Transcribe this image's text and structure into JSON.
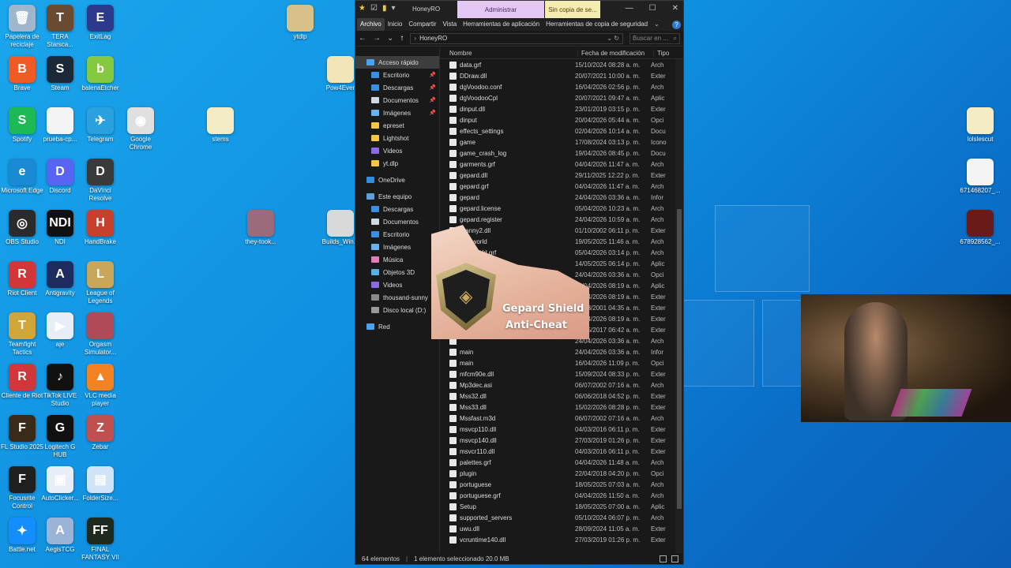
{
  "desktop": {
    "icons": [
      {
        "label": "Papelera de reciclaje",
        "color": "#9fb7cc",
        "glyph": "🗑"
      },
      {
        "label": "TERA Starsca...",
        "color": "#6b4a32",
        "glyph": "T"
      },
      {
        "label": "ExitLag",
        "color": "#2d3a8c",
        "glyph": "E"
      },
      {
        "label": "ytdlp",
        "color": "#d7c188",
        "glyph": ""
      },
      {
        "label": "Brave",
        "color": "#f05a24",
        "glyph": "B"
      },
      {
        "label": "Steam",
        "color": "#1b2838",
        "glyph": "S"
      },
      {
        "label": "balenaEtcher",
        "color": "#85c940",
        "glyph": "b"
      },
      {
        "label": "Pow4Ever",
        "color": "#f2e6b8",
        "glyph": ""
      },
      {
        "label": "Spotify",
        "color": "#1db954",
        "glyph": "S"
      },
      {
        "label": "prueba-cp...",
        "color": "#f4f4f4",
        "glyph": ""
      },
      {
        "label": "Telegram",
        "color": "#2aa1de",
        "glyph": "✈"
      },
      {
        "label": "Google Chrome",
        "color": "#e0e0e0",
        "glyph": "◉"
      },
      {
        "label": "stems",
        "color": "#f4ecc4",
        "glyph": ""
      },
      {
        "label": "Microsoft Edge",
        "color": "#1a8ad4",
        "glyph": "e"
      },
      {
        "label": "Discord",
        "color": "#5865f2",
        "glyph": "D"
      },
      {
        "label": "DaVinci Resolve",
        "color": "#3a3a3a",
        "glyph": "D"
      },
      {
        "label": "OBS Studio",
        "color": "#2b2b2b",
        "glyph": "◎"
      },
      {
        "label": "NDI",
        "color": "#111111",
        "glyph": "NDI"
      },
      {
        "label": "HandBrake",
        "color": "#c7402b",
        "glyph": "H"
      },
      {
        "label": "they-took...",
        "color": "#9b6b7b",
        "glyph": ""
      },
      {
        "label": "Builds_Win...",
        "color": "#d9d9d9",
        "glyph": ""
      },
      {
        "label": "Riot Client",
        "color": "#d13639",
        "glyph": "R"
      },
      {
        "label": "Antigravity",
        "color": "#1d2b5e",
        "glyph": "A"
      },
      {
        "label": "League of Legends",
        "color": "#c8a75a",
        "glyph": "L"
      },
      {
        "label": "Teamfight Tactics",
        "color": "#d0a53a",
        "glyph": "T"
      },
      {
        "label": "aje",
        "color": "#e8eef8",
        "glyph": "▶"
      },
      {
        "label": "Orgasm Simulator...",
        "color": "#b04a5a",
        "glyph": ""
      },
      {
        "label": "Cliente de Riot",
        "color": "#d13639",
        "glyph": "R"
      },
      {
        "label": "TikTok LIVE Studio",
        "color": "#111111",
        "glyph": "♪"
      },
      {
        "label": "VLC media player",
        "color": "#f58220",
        "glyph": "▲"
      },
      {
        "label": "FL Studio 2025",
        "color": "#3a2a1a",
        "glyph": "F"
      },
      {
        "label": "Logitech G HUB",
        "color": "#111111",
        "glyph": "G"
      },
      {
        "label": "Zebar",
        "color": "#c0504d",
        "glyph": "Z"
      },
      {
        "label": "Focusrite Control",
        "color": "#1f1f1f",
        "glyph": "F"
      },
      {
        "label": "AutoClicker...",
        "color": "#e8eef8",
        "glyph": "▣"
      },
      {
        "label": "FolderSize...",
        "color": "#d0e4f7",
        "glyph": "▤"
      },
      {
        "label": "Battle.net",
        "color": "#148eff",
        "glyph": "✦"
      },
      {
        "label": "AegisTCG",
        "color": "#9ab4d8",
        "glyph": "A"
      },
      {
        "label": "FINAL FANTASY VII",
        "color": "#1f2a1f",
        "glyph": "FF"
      },
      {
        "label": "lolslescut",
        "color": "#f4ecc4",
        "glyph": ""
      },
      {
        "label": "671468207_...",
        "color": "#f4f4f4",
        "glyph": ""
      },
      {
        "label": "678928562_...",
        "color": "#6b1a1a",
        "glyph": ""
      }
    ]
  },
  "explorer": {
    "title": "HoneyRO",
    "context_admin": "Administrar",
    "context_backup": "Sin copia de se...",
    "ribbon_tabs": [
      "Archivo",
      "Inicio",
      "Compartir",
      "Vista",
      "Herramientas de aplicación",
      "Herramientas de copia de seguridad"
    ],
    "address": "HoneyRO",
    "search_placeholder": "Buscar en ...",
    "columns": {
      "name": "Nombre",
      "date": "Fecha de modificación",
      "type": "Tipo"
    },
    "nav_items": [
      {
        "label": "Acceso rápido",
        "color": "#4aa3f0",
        "top": true,
        "sel": true
      },
      {
        "label": "Escritorio",
        "color": "#3a8fe0",
        "pin": true
      },
      {
        "label": "Descargas",
        "color": "#3a8fe0",
        "pin": true
      },
      {
        "label": "Documentos",
        "color": "#cfd8e3",
        "pin": true
      },
      {
        "label": "Imágenes",
        "color": "#6cb0f0",
        "pin": true
      },
      {
        "label": "epreset",
        "color": "#f2c744"
      },
      {
        "label": "Lightshot",
        "color": "#f2c744"
      },
      {
        "label": "Videos",
        "color": "#8a6be0"
      },
      {
        "label": "yt.dlp",
        "color": "#f2c744"
      },
      {
        "gap": true
      },
      {
        "label": "OneDrive",
        "color": "#2f8de4",
        "top": true
      },
      {
        "gap": true
      },
      {
        "label": "Este equipo",
        "color": "#5aa0e0",
        "top": true
      },
      {
        "label": "Descargas",
        "color": "#3a8fe0"
      },
      {
        "label": "Documentos",
        "color": "#cfd8e3"
      },
      {
        "label": "Escritorio",
        "color": "#3a8fe0"
      },
      {
        "label": "Imágenes",
        "color": "#6cb0f0"
      },
      {
        "label": "Música",
        "color": "#e57ab8"
      },
      {
        "label": "Objetos 3D",
        "color": "#58b0e8"
      },
      {
        "label": "Videos",
        "color": "#8a6be0"
      },
      {
        "label": "thousand-sunny",
        "color": "#8a8a8a"
      },
      {
        "label": "Disco local (D:)",
        "color": "#9a9a9a"
      },
      {
        "gap": true
      },
      {
        "label": "Red",
        "color": "#4aa3f0",
        "top": true
      }
    ],
    "files": [
      {
        "name": "data.grf",
        "date": "15/10/2024 08:28 a. m.",
        "type": "Arch"
      },
      {
        "name": "DDraw.dll",
        "date": "20/07/2021 10:00 a. m.",
        "type": "Exter"
      },
      {
        "name": "dgVoodoo.conf",
        "date": "16/04/2026 02:56 p. m.",
        "type": "Arch"
      },
      {
        "name": "dgVoodooCpl",
        "date": "20/07/2021 09:47 a. m.",
        "type": "Aplic"
      },
      {
        "name": "dinput.dll",
        "date": "23/01/2019 03:15 p. m.",
        "type": "Exter"
      },
      {
        "name": "dinput",
        "date": "20/04/2026 05:44 a. m.",
        "type": "Opci"
      },
      {
        "name": "effects_settings",
        "date": "02/04/2026 10:14 a. m.",
        "type": "Docu"
      },
      {
        "name": "game",
        "date": "17/08/2024 03:13 p. m.",
        "type": "Icono"
      },
      {
        "name": "game_crash_log",
        "date": "19/04/2026 08:45 p. m.",
        "type": "Docu"
      },
      {
        "name": "garments.grf",
        "date": "04/04/2026 11:47 a. m.",
        "type": "Arch"
      },
      {
        "name": "gepard.dll",
        "date": "29/11/2025 12:22 p. m.",
        "type": "Exter"
      },
      {
        "name": "gepard.grf",
        "date": "04/04/2026 11:47 a. m.",
        "type": "Arch"
      },
      {
        "name": "gepard",
        "date": "24/04/2026 03:36 a. m.",
        "type": "Infor"
      },
      {
        "name": "gepard.license",
        "date": "05/04/2026 10:23 a. m.",
        "type": "Arch"
      },
      {
        "name": "gepard.register",
        "date": "24/04/2026 10:59 a. m.",
        "type": "Arch"
      },
      {
        "name": "granny2.dll",
        "date": "01/10/2002 06:11 p. m.",
        "type": "Exter"
      },
      {
        "name": "greyworld",
        "date": "19/05/2025 11:46 a. m.",
        "type": "Arch"
      },
      {
        "name": "greyworld.grf",
        "date": "05/04/2026 03:14 p. m.",
        "type": "Arch"
      },
      {
        "name": "",
        "date": "14/05/2025 06:14 p. m.",
        "type": "Aplic"
      },
      {
        "name": "",
        "date": "24/04/2026 03:36 a. m.",
        "type": "Opci"
      },
      {
        "name": "",
        "date": "04/04/2026 08:19 a. m.",
        "type": "Aplic"
      },
      {
        "name": "",
        "date": "04/04/2026 08:19 a. m.",
        "type": "Exter"
      },
      {
        "name": "",
        "date": "01/03/2001 04:35 a. m.",
        "type": "Exter"
      },
      {
        "name": "",
        "date": "04/04/2026 08:19 a. m.",
        "type": "Exter"
      },
      {
        "name": "",
        "date": "14/05/2017 06:42 a. m.",
        "type": "Exter"
      },
      {
        "name": "",
        "date": "24/04/2026 03:36 a. m.",
        "type": "Arch"
      },
      {
        "name": "main",
        "date": "24/04/2026 03:36 a. m.",
        "type": "Infor"
      },
      {
        "name": "main",
        "date": "16/04/2026 11:09 p. m.",
        "type": "Opci"
      },
      {
        "name": "mfcm90e.dll",
        "date": "15/09/2024 08:33 p. m.",
        "type": "Exter"
      },
      {
        "name": "Mp3dec.asi",
        "date": "06/07/2002 07:16 a. m.",
        "type": "Arch"
      },
      {
        "name": "Mss32.dll",
        "date": "06/06/2018 04:52 p. m.",
        "type": "Exter"
      },
      {
        "name": "Mss33.dll",
        "date": "15/02/2026 08:28 p. m.",
        "type": "Exter"
      },
      {
        "name": "Mssfast.m3d",
        "date": "06/07/2002 07:16 a. m.",
        "type": "Arch"
      },
      {
        "name": "msvcp110.dll",
        "date": "04/03/2016 06:11 p. m.",
        "type": "Exter"
      },
      {
        "name": "msvcp140.dll",
        "date": "27/03/2019 01:26 p. m.",
        "type": "Exter"
      },
      {
        "name": "msvcr110.dll",
        "date": "04/03/2016 06:11 p. m.",
        "type": "Exter"
      },
      {
        "name": "palettes.grf",
        "date": "04/04/2026 11:48 a. m.",
        "type": "Arch"
      },
      {
        "name": "plugin",
        "date": "22/04/2018 04:20 p. m.",
        "type": "Opci"
      },
      {
        "name": "portuguese",
        "date": "18/05/2025 07:03 a. m.",
        "type": "Arch"
      },
      {
        "name": "portuguese.grf",
        "date": "04/04/2026 11:50 a. m.",
        "type": "Arch"
      },
      {
        "name": "Setup",
        "date": "18/05/2025 07:00 a. m.",
        "type": "Aplic"
      },
      {
        "name": "supported_servers",
        "date": "05/10/2024 06:07 p. m.",
        "type": "Arch"
      },
      {
        "name": "uwu.dll",
        "date": "28/09/2024 11:05 a. m.",
        "type": "Exter"
      },
      {
        "name": "vcruntime140.dll",
        "date": "27/03/2019 01:26 p. m.",
        "type": "Exter"
      }
    ],
    "status": {
      "count": "64 elementos",
      "selected": "1 elemento seleccionado  20.0 MB"
    }
  },
  "gepard": {
    "line1": "Gepard Shield",
    "line2": "Anti-Cheat"
  }
}
